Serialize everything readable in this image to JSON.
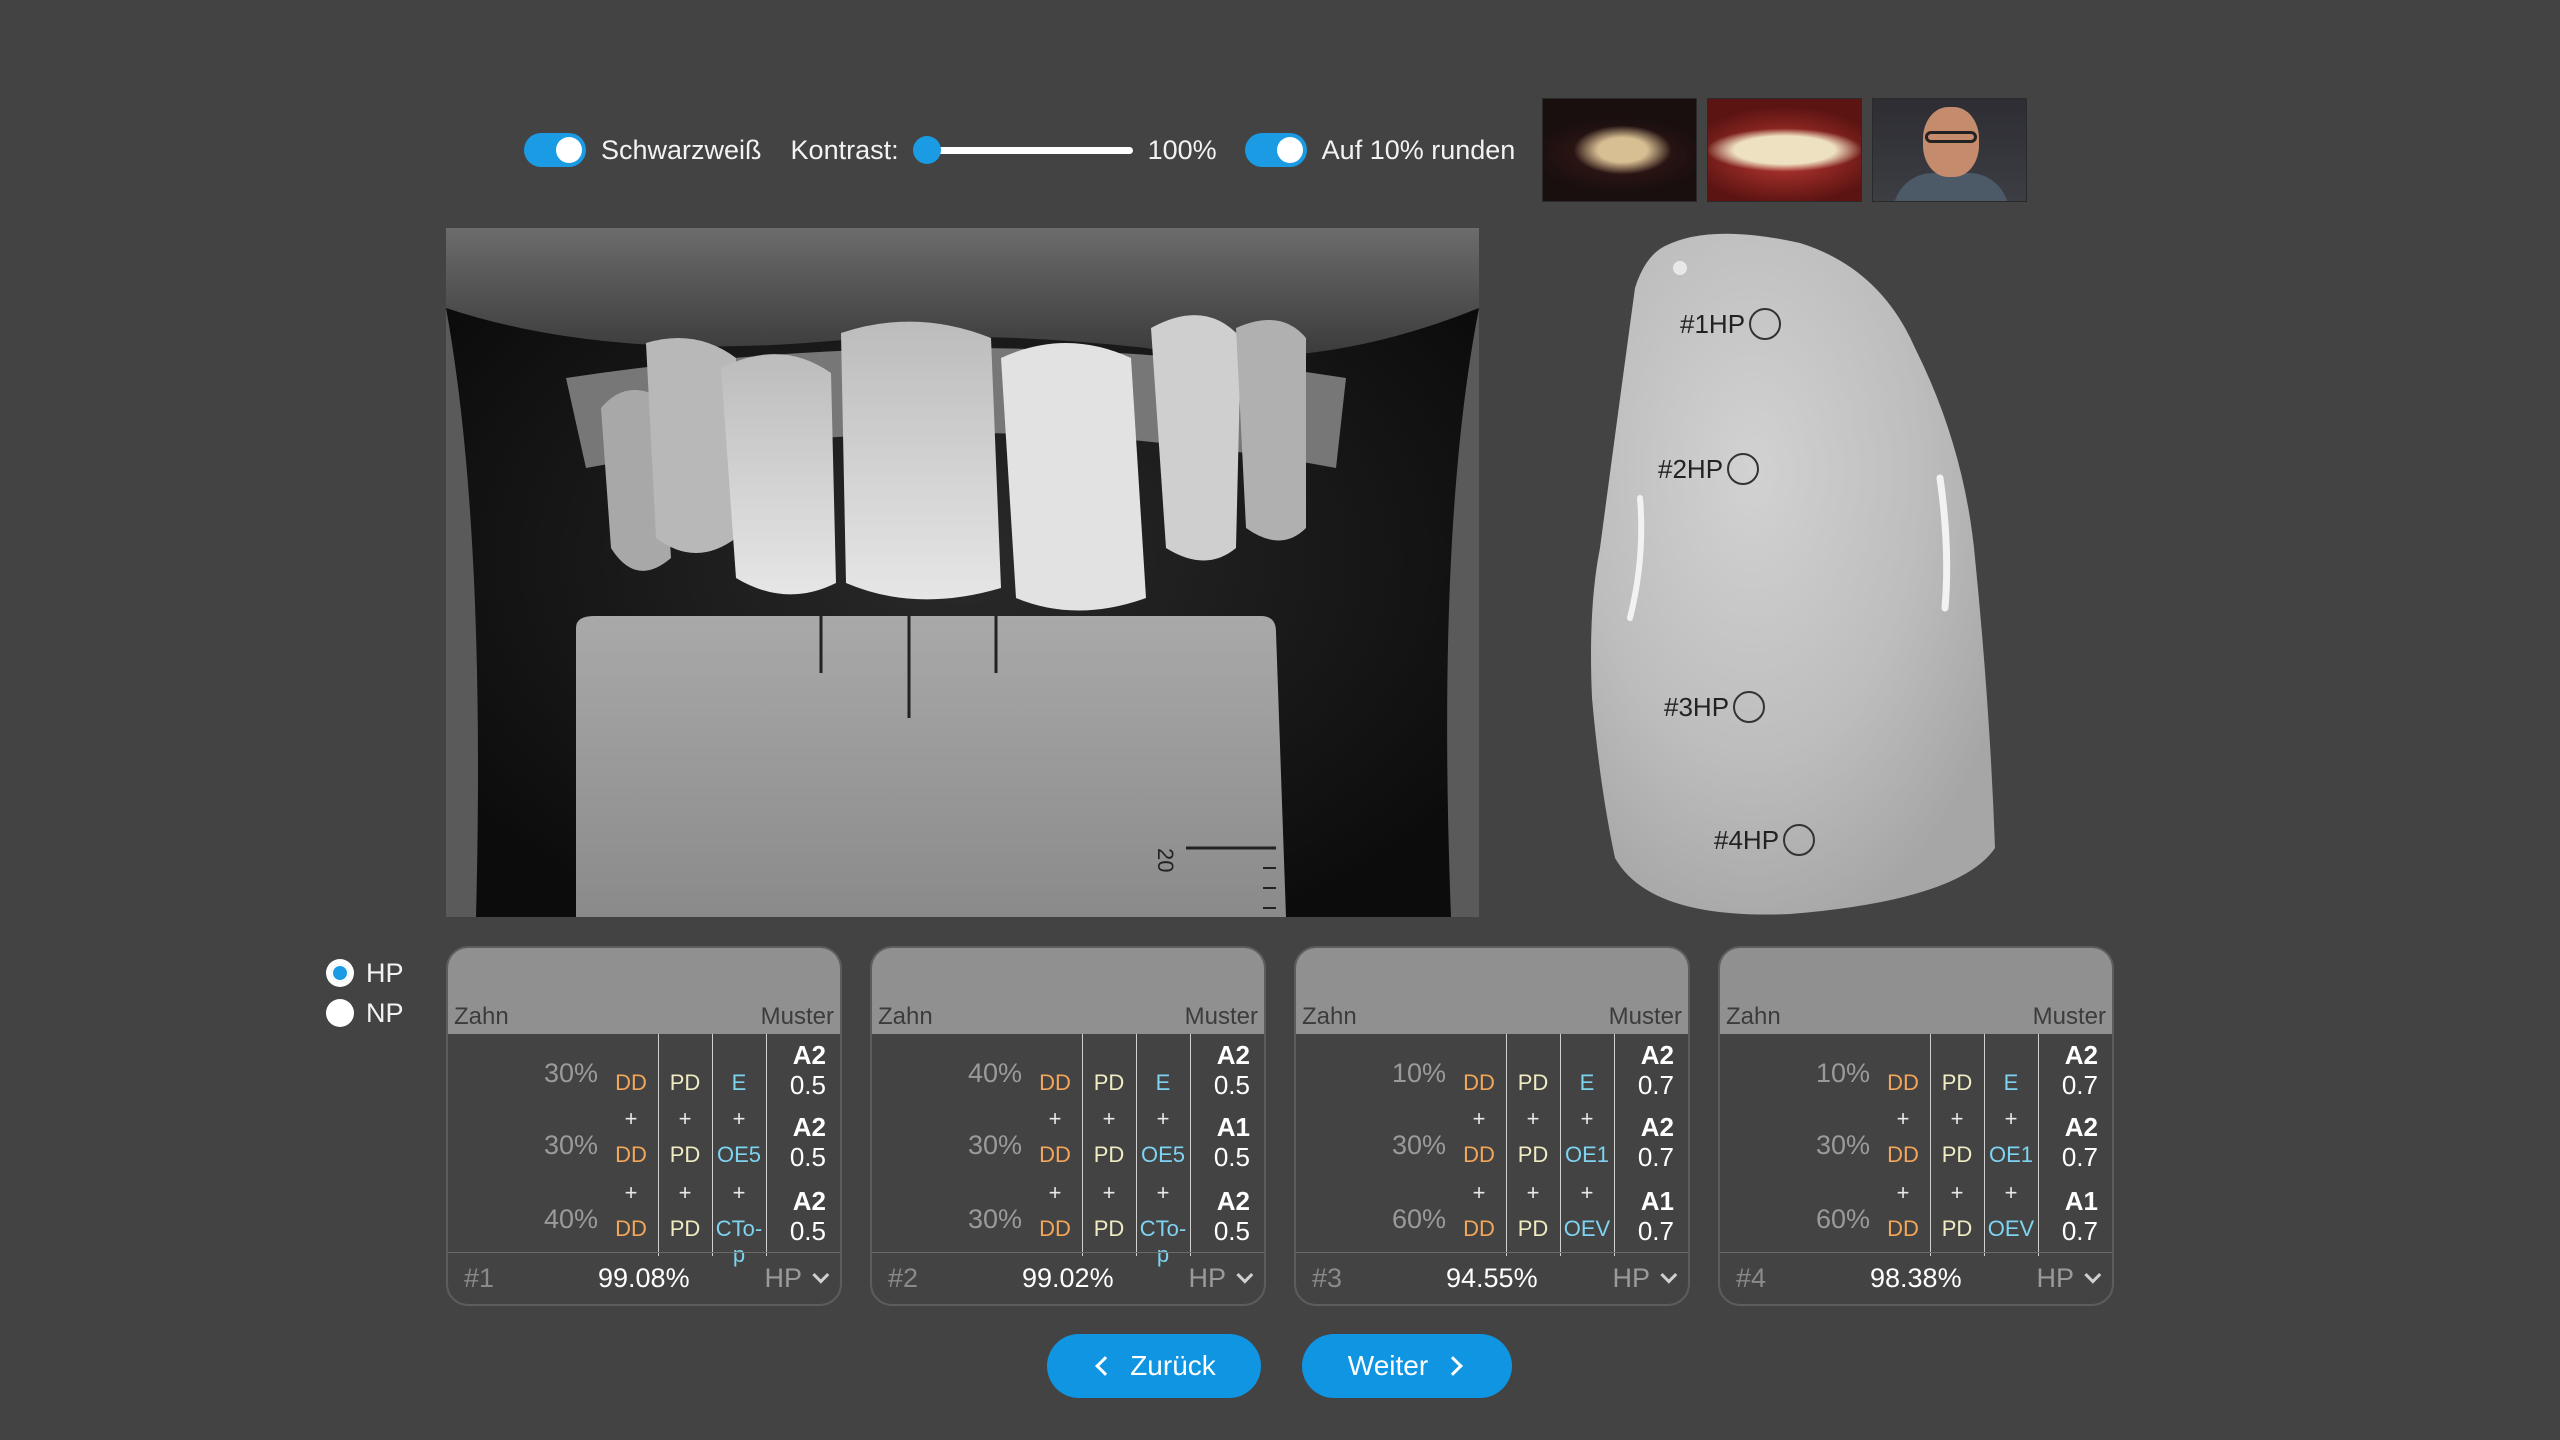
{
  "toolbar": {
    "bw_label": "Schwarzweiß",
    "bw_on": true,
    "contrast_label": "Kontrast:",
    "contrast_value": "100%",
    "contrast_level": 0,
    "round_label": "Auf 10% runden",
    "round_on": true,
    "thumbnails": [
      "smile-dark-thumbnail",
      "smile-color-thumbnail",
      "portrait-thumbnail"
    ]
  },
  "photo": {
    "scale_label": "20"
  },
  "shade_map": {
    "markers": [
      {
        "label": "#1HP"
      },
      {
        "label": "#2HP"
      },
      {
        "label": "#3HP"
      },
      {
        "label": "#4HP"
      }
    ]
  },
  "mode": {
    "options": [
      {
        "label": "HP",
        "selected": true
      },
      {
        "label": "NP",
        "selected": false
      }
    ]
  },
  "cards": [
    {
      "header_zahn": "Zahn",
      "header_muster": "Muster",
      "rows": [
        {
          "pct": "30%",
          "ex": "E",
          "shade": "A2",
          "value": "0.5"
        },
        {
          "pct": "30%",
          "ex": "OE5",
          "shade": "A2",
          "value": "0.5"
        },
        {
          "pct": "40%",
          "ex": "CTo-p",
          "shade": "A2",
          "value": "0.5"
        }
      ],
      "number": "#1",
      "score": "99.08%",
      "mode": "HP"
    },
    {
      "header_zahn": "Zahn",
      "header_muster": "Muster",
      "rows": [
        {
          "pct": "40%",
          "ex": "E",
          "shade": "A2",
          "value": "0.5"
        },
        {
          "pct": "30%",
          "ex": "OE5",
          "shade": "A1",
          "value": "0.5"
        },
        {
          "pct": "30%",
          "ex": "CTo-p",
          "shade": "A2",
          "value": "0.5"
        }
      ],
      "number": "#2",
      "score": "99.02%",
      "mode": "HP"
    },
    {
      "header_zahn": "Zahn",
      "header_muster": "Muster",
      "rows": [
        {
          "pct": "10%",
          "ex": "E",
          "shade": "A2",
          "value": "0.7"
        },
        {
          "pct": "30%",
          "ex": "OE1",
          "shade": "A2",
          "value": "0.7"
        },
        {
          "pct": "60%",
          "ex": "OEV",
          "shade": "A1",
          "value": "0.7"
        }
      ],
      "number": "#3",
      "score": "94.55%",
      "mode": "HP"
    },
    {
      "header_zahn": "Zahn",
      "header_muster": "Muster",
      "rows": [
        {
          "pct": "10%",
          "ex": "E",
          "shade": "A2",
          "value": "0.7"
        },
        {
          "pct": "30%",
          "ex": "OE1",
          "shade": "A2",
          "value": "0.7"
        },
        {
          "pct": "60%",
          "ex": "OEV",
          "shade": "A1",
          "value": "0.7"
        }
      ],
      "number": "#4",
      "score": "98.38%",
      "mode": "HP"
    }
  ],
  "cell_labels": {
    "dd": "DD",
    "pd": "PD",
    "plus": "+"
  },
  "nav": {
    "back_label": "Zurück",
    "next_label": "Weiter"
  },
  "colors": {
    "accent": "#1a9be4",
    "background": "#434343",
    "dd": "#f2a65a",
    "ex": "#7ed3f0"
  }
}
